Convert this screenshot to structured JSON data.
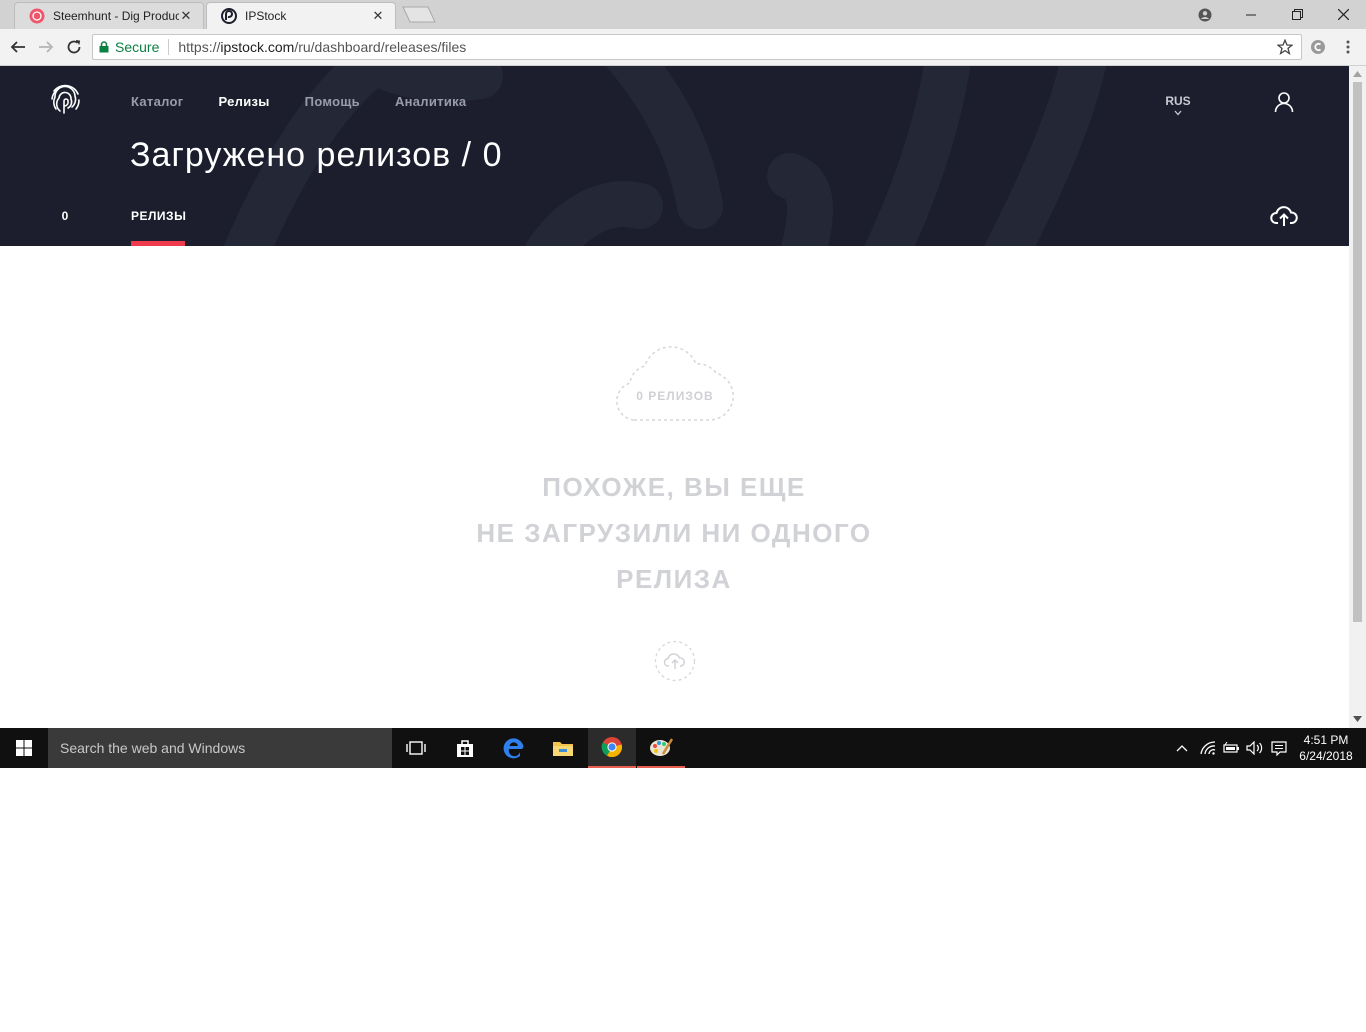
{
  "browser": {
    "tabs": [
      {
        "title": "Steemhunt - Dig Product",
        "active": false
      },
      {
        "title": "IPStock",
        "active": true
      }
    ],
    "secure_label": "Secure",
    "url_scheme": "https://",
    "url_host": "ipstock.com",
    "url_path": "/ru/dashboard/releases/files"
  },
  "site": {
    "nav": [
      {
        "label": "Каталог",
        "current": false
      },
      {
        "label": "Релизы",
        "current": true
      },
      {
        "label": "Помощь",
        "current": false
      },
      {
        "label": "Аналитика",
        "current": false
      }
    ],
    "language": "RUS",
    "page_title": "Загружено релизов / 0",
    "counter": "0",
    "tab_label": "РЕЛИЗЫ",
    "accent_color": "#ee3a4c",
    "header_bg": "#1c1e2d"
  },
  "empty_state": {
    "cloud_label": "0 РЕЛИЗОВ",
    "message_line1": "ПОХОЖЕ, ВЫ ЕЩЕ",
    "message_line2": "НЕ ЗАГРУЗИЛИ НИ ОДНОГО",
    "message_line3": "РЕЛИЗА"
  },
  "taskbar": {
    "search_placeholder": "Search the web and Windows",
    "time": "4:51 PM",
    "date": "6/24/2018",
    "apps": [
      "task-view-icon",
      "store-icon",
      "edge-icon",
      "file-explorer-icon",
      "chrome-icon",
      "paint-icon"
    ]
  }
}
